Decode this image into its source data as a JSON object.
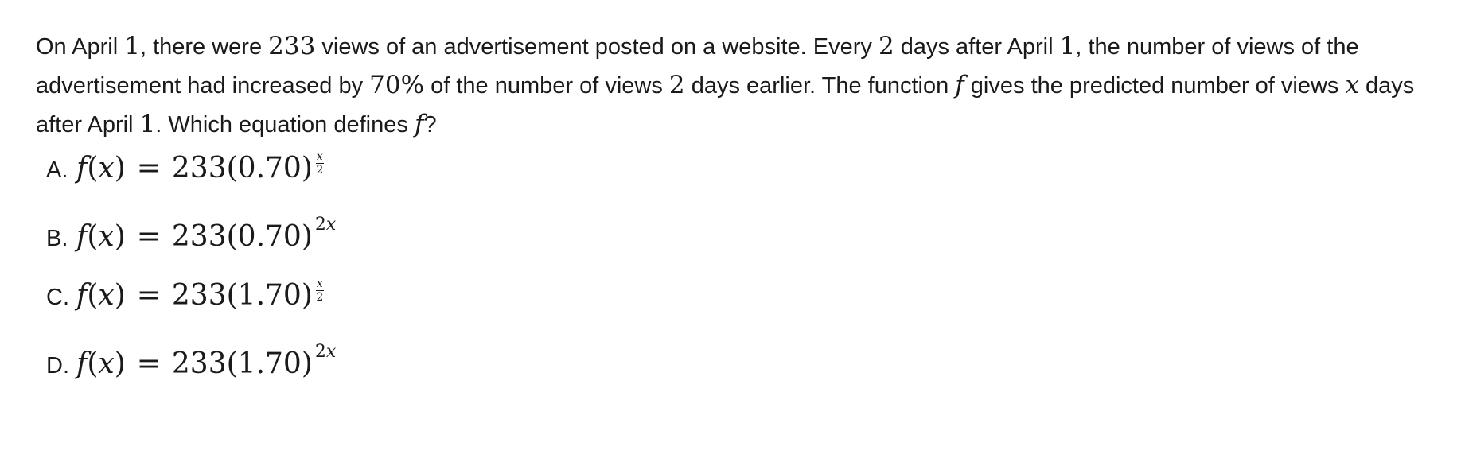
{
  "question": {
    "t1": "On April ",
    "n1": "1",
    "t2": ", there were ",
    "n2": "233",
    "t3": " views of an advertisement posted on a website. Every ",
    "n3": "2",
    "t4": " days after April ",
    "n4": "1",
    "t5": ", the number of views of the advertisement had increased by ",
    "n5": "70%",
    "t6": " of the number of views ",
    "n6": "2",
    "t7": " days earlier. The function ",
    "v1": "f",
    "t8": " gives the predicted number of views ",
    "v2": "x",
    "t9": " days after April ",
    "n7": "1",
    "t10": ". Which equation defines ",
    "v3": "f",
    "t11": "?"
  },
  "choices": [
    {
      "letter": "A.",
      "func": "f",
      "arg": "x",
      "equals": "=",
      "coef": "233",
      "base": "(0.70)",
      "exp_type": "fraction",
      "exp_num": "x",
      "exp_den": "2"
    },
    {
      "letter": "B.",
      "func": "f",
      "arg": "x",
      "equals": "=",
      "coef": "233",
      "base": "(0.70)",
      "exp_type": "product",
      "exp_coef": "2",
      "exp_var": "x"
    },
    {
      "letter": "C.",
      "func": "f",
      "arg": "x",
      "equals": "=",
      "coef": "233",
      "base": "(1.70)",
      "exp_type": "fraction",
      "exp_num": "x",
      "exp_den": "2"
    },
    {
      "letter": "D.",
      "func": "f",
      "arg": "x",
      "equals": "=",
      "coef": "233",
      "base": "(1.70)",
      "exp_type": "product",
      "exp_coef": "2",
      "exp_var": "x"
    }
  ]
}
